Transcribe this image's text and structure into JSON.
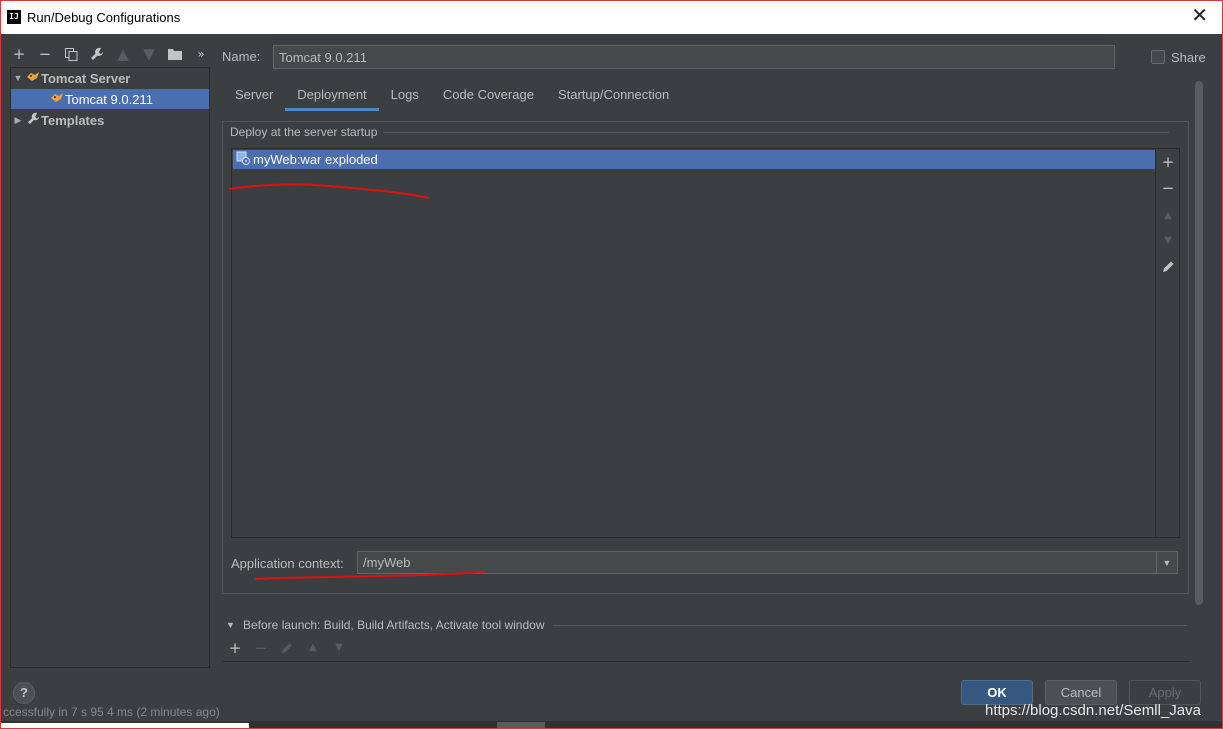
{
  "window": {
    "title": "Run/Debug Configurations",
    "app_icon_text": "IJ",
    "close_glyph": "✕"
  },
  "left_toolbar": {
    "icons": [
      "add-icon",
      "remove-icon",
      "copy-icon",
      "wrench-icon",
      "move-up-icon",
      "move-down-icon",
      "folder-icon",
      "more-icon"
    ]
  },
  "tree": {
    "group_label": "Tomcat Server",
    "item_label": "Tomcat 9.0.211",
    "templates_label": "Templates"
  },
  "name_row": {
    "label": "Name:",
    "value": "Tomcat 9.0.211",
    "share_label": "Share"
  },
  "tabs": [
    {
      "label": "Server"
    },
    {
      "label": "Deployment"
    },
    {
      "label": "Logs"
    },
    {
      "label": "Code Coverage"
    },
    {
      "label": "Startup/Connection"
    }
  ],
  "active_tab": "Deployment",
  "deployment": {
    "group_title": "Deploy at the server startup",
    "artifacts": [
      "myWeb:war exploded"
    ],
    "context_label": "Application context:",
    "context_value": "/myWeb"
  },
  "before_launch": {
    "title": "Before launch: Build, Build Artifacts, Activate tool window"
  },
  "buttons": {
    "help": "?",
    "ok": "OK",
    "cancel": "Cancel",
    "apply": "Apply"
  },
  "status_text": "ccessfully in 7 s 95 4 ms (2 minutes ago)",
  "watermark": "https://blog.csdn.net/Semll_Java",
  "colors": {
    "background": "#3c3f41",
    "selection": "#4b6eaf",
    "accent_tab": "#4a88c7",
    "ok_button": "#365880",
    "annotation_red": "#e01010"
  }
}
